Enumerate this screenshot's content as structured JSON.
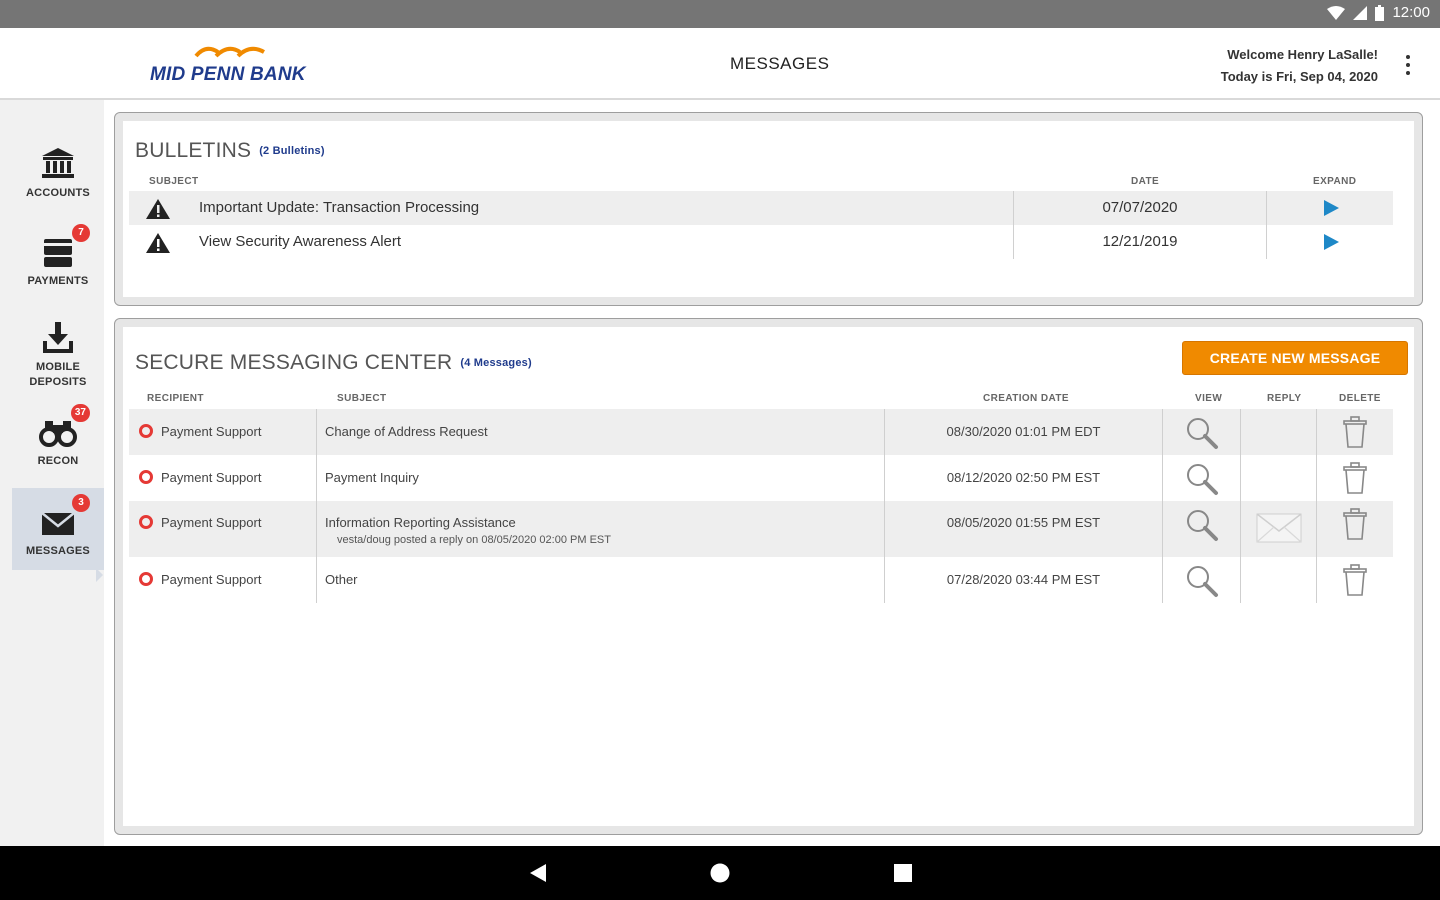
{
  "status_bar": {
    "time": "12:00"
  },
  "header": {
    "logo_text": "MID PENN BANK",
    "page_title": "MESSAGES",
    "welcome": "Welcome Henry LaSalle!",
    "today": "Today is Fri, Sep 04, 2020"
  },
  "sidebar": {
    "items": [
      {
        "label": "ACCOUNTS",
        "icon": "bank-icon",
        "badge": ""
      },
      {
        "label": "PAYMENTS",
        "icon": "payments-icon",
        "badge": "7"
      },
      {
        "label_line1": "MOBILE",
        "label_line2": "DEPOSITS",
        "icon": "deposit-icon",
        "badge": ""
      },
      {
        "label": "RECON",
        "icon": "binoculars-icon",
        "badge": "37"
      },
      {
        "label": "MESSAGES",
        "icon": "envelope-icon",
        "badge": "3"
      }
    ]
  },
  "bulletins": {
    "title": "BULLETINS",
    "count": "(2 Bulletins)",
    "col_subject": "SUBJECT",
    "col_date": "DATE",
    "col_expand": "EXPAND",
    "rows": [
      {
        "subject": "Important Update: Transaction Processing",
        "date": "07/07/2020"
      },
      {
        "subject": "View Security Awareness Alert",
        "date": "12/21/2019"
      }
    ]
  },
  "messaging": {
    "title": "SECURE MESSAGING CENTER",
    "count": "(4 Messages)",
    "create_button": "CREATE NEW MESSAGE",
    "col_recipient": "RECIPIENT",
    "col_subject": "SUBJECT",
    "col_creation_date": "CREATION DATE",
    "col_view": "VIEW",
    "col_reply": "REPLY",
    "col_delete": "DELETE",
    "rows": [
      {
        "recipient": "Payment Support",
        "subject": "Change of Address Request",
        "note": "",
        "date": "08/30/2020 01:01 PM EDT",
        "has_reply": false
      },
      {
        "recipient": "Payment Support",
        "subject": "Payment Inquiry",
        "note": "",
        "date": "08/12/2020 02:50 PM EST",
        "has_reply": false
      },
      {
        "recipient": "Payment Support",
        "subject": "Information Reporting Assistance",
        "note": "vesta/doug posted a reply on 08/05/2020 02:00 PM EST",
        "date": "08/05/2020 01:55 PM EST",
        "has_reply": true
      },
      {
        "recipient": "Payment Support",
        "subject": "Other",
        "note": "",
        "date": "07/28/2020 03:44 PM EST",
        "has_reply": false
      }
    ]
  },
  "colors": {
    "accent": "#f08a00",
    "brand_blue": "#1f3b8c",
    "badge": "#e53935",
    "expand_arrow": "#1e88c7"
  }
}
